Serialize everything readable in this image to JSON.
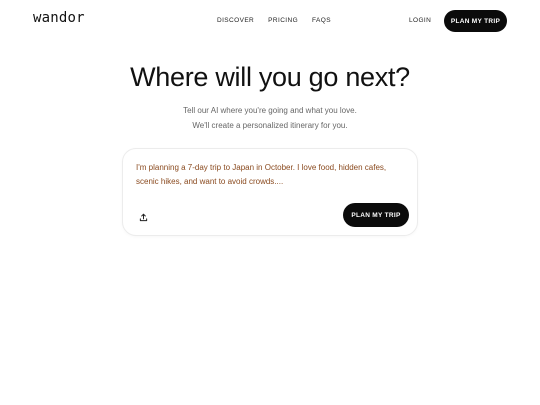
{
  "brand": {
    "logo": "wandor"
  },
  "nav": {
    "items": [
      {
        "label": "DISCOVER"
      },
      {
        "label": "PRICING"
      },
      {
        "label": "FAQS"
      }
    ],
    "login_label": "LOGIN",
    "cta_label": "PLAN MY TRIP"
  },
  "hero": {
    "title": "Where will you go next?",
    "subtitle_line1": "Tell our AI where you're going and what you love.",
    "subtitle_line2": "We'll create a personalized itinerary for you."
  },
  "prompt_card": {
    "text": "I'm planning a 7-day trip to Japan in October. I love food, hidden cafes, scenic hikes, and want to avoid crowds....",
    "upload_icon": "upload-icon",
    "submit_label": "PLAN MY TRIP"
  },
  "colors": {
    "primary_button": "#0b0b0b",
    "prompt_text": "#8a4a1f",
    "subtitle": "#666666"
  }
}
